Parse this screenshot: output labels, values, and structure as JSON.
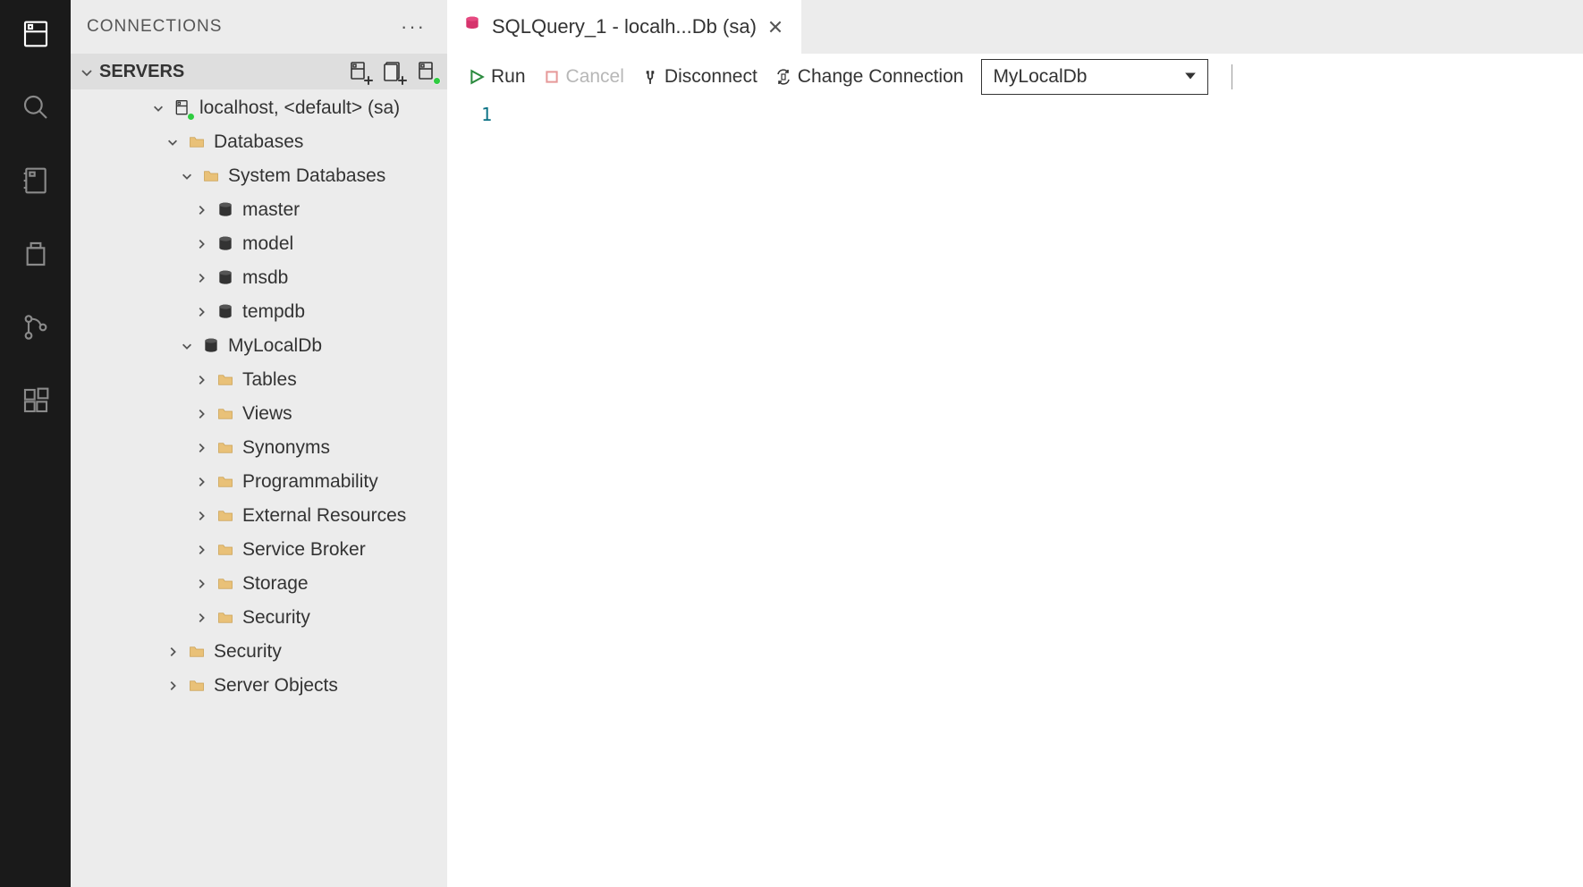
{
  "activityBar": {
    "items": [
      {
        "name": "connections",
        "active": true
      },
      {
        "name": "search",
        "active": false
      },
      {
        "name": "notebooks",
        "active": false
      },
      {
        "name": "explorer",
        "active": false
      },
      {
        "name": "source-control",
        "active": false
      },
      {
        "name": "extensions",
        "active": false
      }
    ]
  },
  "sidePanel": {
    "title": "CONNECTIONS",
    "more": "···",
    "section": {
      "label": "SERVERS"
    },
    "tree": {
      "server": {
        "label": "localhost, <default> (sa)"
      },
      "databasesFolder": {
        "label": "Databases"
      },
      "systemDatabasesFolder": {
        "label": "System Databases"
      },
      "systemDbs": [
        {
          "label": "master"
        },
        {
          "label": "model"
        },
        {
          "label": "msdb"
        },
        {
          "label": "tempdb"
        }
      ],
      "userDb": {
        "label": "MyLocalDb"
      },
      "userDbFolders": [
        {
          "label": "Tables"
        },
        {
          "label": "Views"
        },
        {
          "label": "Synonyms"
        },
        {
          "label": "Programmability"
        },
        {
          "label": "External Resources"
        },
        {
          "label": "Service Broker"
        },
        {
          "label": "Storage"
        },
        {
          "label": "Security"
        }
      ],
      "serverFolders": [
        {
          "label": "Security"
        },
        {
          "label": "Server Objects"
        }
      ]
    }
  },
  "editor": {
    "tab": {
      "label": "SQLQuery_1 - localh...Db (sa)"
    },
    "toolbar": {
      "run": "Run",
      "cancel": "Cancel",
      "disconnect": "Disconnect",
      "changeConnection": "Change Connection",
      "dbSelect": "MyLocalDb"
    },
    "gutter": {
      "line1": "1"
    }
  }
}
